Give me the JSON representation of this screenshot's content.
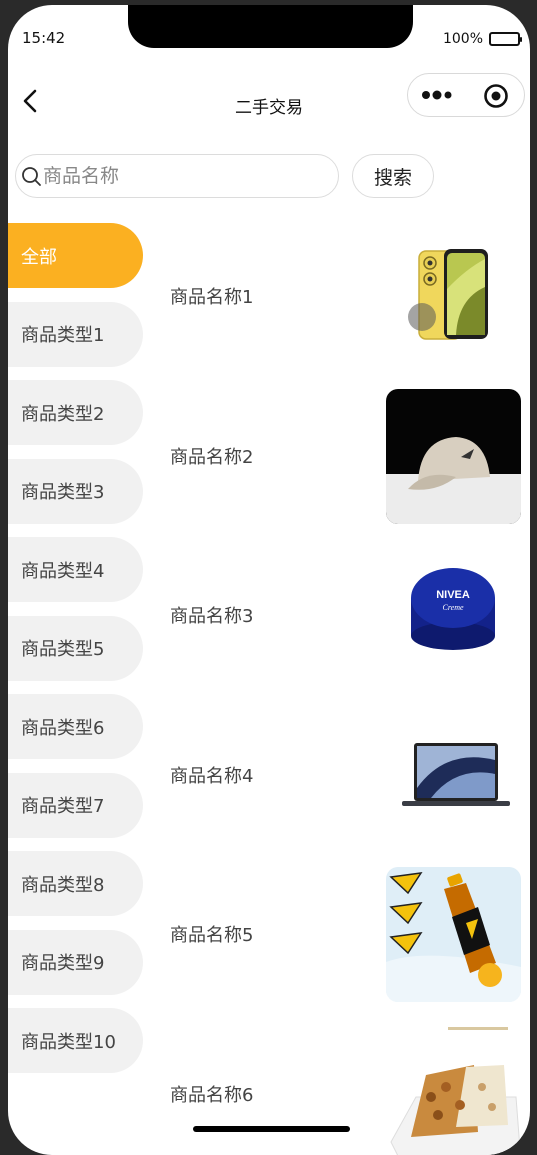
{
  "status": {
    "time": "15:42",
    "battery": "100%"
  },
  "nav": {
    "title": "二手交易"
  },
  "search": {
    "placeholder": "商品名称",
    "button_label": "搜索"
  },
  "categories": [
    {
      "label": "全部",
      "active": true
    },
    {
      "label": "商品类型1"
    },
    {
      "label": "商品类型2"
    },
    {
      "label": "商品类型3"
    },
    {
      "label": "商品类型4"
    },
    {
      "label": "商品类型5"
    },
    {
      "label": "商品类型6"
    },
    {
      "label": "商品类型7"
    },
    {
      "label": "商品类型8"
    },
    {
      "label": "商品类型9"
    },
    {
      "label": "商品类型10"
    }
  ],
  "goods": [
    {
      "name": "商品名称1",
      "image": "yellow-phone"
    },
    {
      "name": "商品名称2",
      "image": "cap"
    },
    {
      "name": "商品名称3",
      "image": "blue-cream-tin"
    },
    {
      "name": "商品名称4",
      "image": "laptop"
    },
    {
      "name": "商品名称5",
      "image": "drink-bottle"
    },
    {
      "name": "商品名称6",
      "image": "snack-plate"
    }
  ],
  "colors": {
    "accent": "#fbb021",
    "category_bg": "#f1f1f1"
  }
}
